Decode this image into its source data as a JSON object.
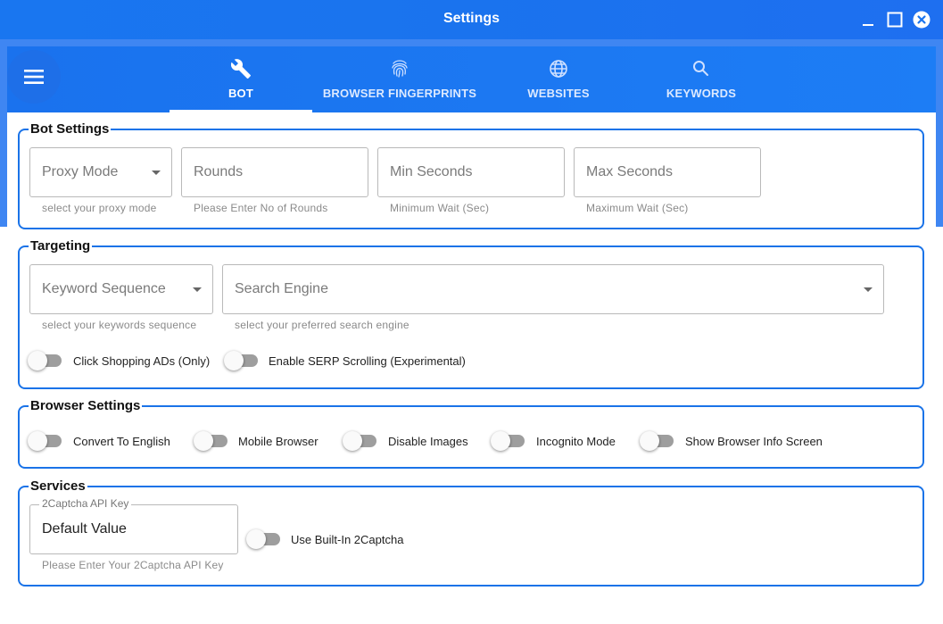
{
  "window": {
    "title": "Settings"
  },
  "tabs": [
    {
      "label": "BOT",
      "icon": "wrench-icon",
      "active": true
    },
    {
      "label": "BROWSER FINGERPRINTS",
      "icon": "fingerprint-icon",
      "active": false
    },
    {
      "label": "WEBSITES",
      "icon": "globe-icon",
      "active": false
    },
    {
      "label": "KEYWORDS",
      "icon": "search-icon",
      "active": false
    }
  ],
  "bot_settings": {
    "legend": "Bot Settings",
    "proxy_mode": {
      "placeholder": "Proxy Mode",
      "hint": "select your proxy mode"
    },
    "rounds": {
      "placeholder": "Rounds",
      "hint": "Please Enter No of Rounds"
    },
    "min_seconds": {
      "placeholder": "Min Seconds",
      "hint": "Minimum Wait (Sec)"
    },
    "max_seconds": {
      "placeholder": "Max Seconds",
      "hint": "Maximum Wait (Sec)"
    }
  },
  "targeting": {
    "legend": "Targeting",
    "keyword_sequence": {
      "placeholder": "Keyword Sequence",
      "hint": "select your keywords sequence"
    },
    "search_engine": {
      "placeholder": "Search Engine",
      "hint": "select your preferred search engine"
    },
    "click_shopping_ads": {
      "label": "Click Shopping ADs (Only)",
      "on": false
    },
    "serp_scrolling": {
      "label": "Enable SERP Scrolling (Experimental)",
      "on": false
    }
  },
  "browser_settings": {
    "legend": "Browser Settings",
    "convert_to_english": {
      "label": "Convert To English",
      "on": false
    },
    "mobile_browser": {
      "label": "Mobile Browser",
      "on": false
    },
    "disable_images": {
      "label": "Disable Images",
      "on": false
    },
    "incognito_mode": {
      "label": "Incognito Mode",
      "on": false
    },
    "show_browser_info": {
      "label": "Show Browser Info Screen",
      "on": false
    }
  },
  "services": {
    "legend": "Services",
    "captcha_key": {
      "label": "2Captcha API Key",
      "value": "Default Value",
      "hint": "Please Enter Your 2Captcha API Key"
    },
    "use_builtin_2captcha": {
      "label": "Use Built-In 2Captcha",
      "on": false
    }
  },
  "colors": {
    "accent": "#1a73e8",
    "titlebar": "#1976f0"
  }
}
